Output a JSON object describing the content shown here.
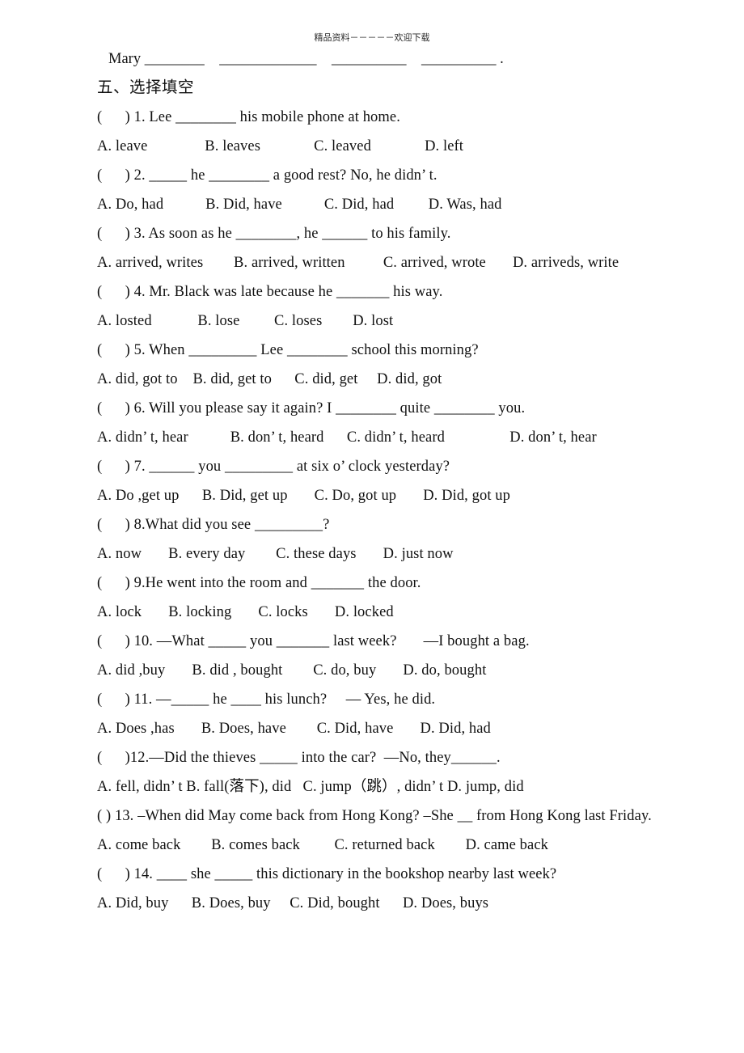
{
  "header": {
    "watermark": "精品资料－－－－－欢迎下载"
  },
  "carryover_line": {
    "text": "Mary ________    _____________    __________    __________ ."
  },
  "section": {
    "heading": "五、选择填空"
  },
  "questions": [
    {
      "stem": "(      ) 1. Lee ________ his mobile phone at home.",
      "options": "A. leave               B. leaves              C. leaved              D. left"
    },
    {
      "stem": "(      ) 2. _____ he ________ a good rest? No, he didn’ t.",
      "options": "A. Do, had           B. Did, have           C. Did, had         D. Was, had"
    },
    {
      "stem": "(      ) 3. As soon as he ________, he ______ to his family.",
      "options": "A. arrived, writes        B. arrived, written          C. arrived, wrote       D. arriveds, write"
    },
    {
      "stem": "(      ) 4. Mr. Black was late because he _______ his way.",
      "options": "A. losted            B. lose         C. loses        D. lost"
    },
    {
      "stem": "(      ) 5. When _________ Lee ________ school this morning?",
      "options": "A. did, got to    B. did, get to      C. did, get     D. did, got"
    },
    {
      "stem": "(      ) 6. Will you please say it again? I ________ quite ________ you.",
      "options": "A. didn’ t, hear           B. don’ t, heard      C. didn’ t, heard                 D. don’ t, hear"
    },
    {
      "stem": "(      ) 7. ______ you _________ at six o’ clock yesterday?",
      "options": "A. Do ,get up      B. Did, get up       C. Do, got up       D. Did, got up"
    },
    {
      "stem": "(      ) 8.What did you see _________?",
      "options": "A. now       B. every day        C. these days       D. just now"
    },
    {
      "stem": "(      ) 9.He went into the room and _______ the door.",
      "options": "A. lock       B. locking       C. locks       D. locked"
    },
    {
      "stem": "(      ) 10. —What _____ you _______ last week?       —I bought a bag.",
      "options": "A. did ,buy       B. did , bought        C. do, buy       D. do, bought"
    },
    {
      "stem": "(      ) 11. —_____ he ____ his lunch?     — Yes, he did.",
      "options": "A. Does ,has       B. Does, have        C. Did, have       D. Did, had"
    },
    {
      "stem": "(      )12.—Did the thieves _____ into the car?  —No, they______.",
      "options": "A. fell, didn’ t B. fall(落下), did   C. jump（跳）, didn’ t D. jump, did"
    },
    {
      "stem": "(      ) 13. –When did May come back from Hong Kong?      –She __ from Hong Kong last Friday.",
      "options": "A. come back        B. comes back         C. returned back        D. came back"
    },
    {
      "stem": "(      ) 14. ____ she _____ this dictionary in the bookshop nearby last week?",
      "options": "A. Did, buy      B. Does, buy     C. Did, bought      D. Does, buys"
    }
  ]
}
